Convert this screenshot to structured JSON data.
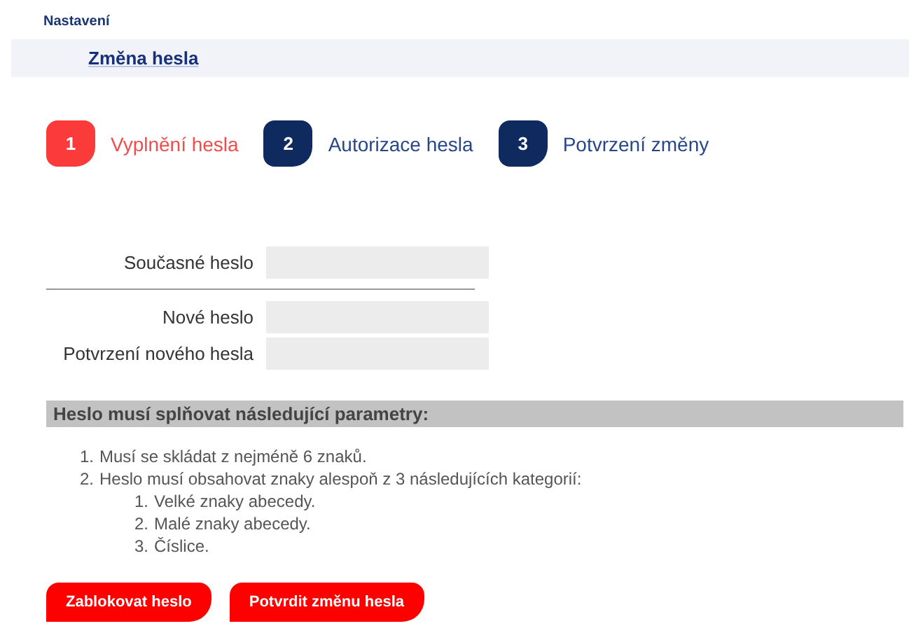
{
  "breadcrumb": "Nastavení",
  "page_title": "Změna hesla",
  "steps": [
    {
      "number": "1",
      "label": "Vyplnění hesla",
      "selected": true
    },
    {
      "number": "2",
      "label": "Autorizace hesla",
      "selected": false
    },
    {
      "number": "3",
      "label": "Potvrzení změny",
      "selected": false
    }
  ],
  "form": {
    "current": [
      {
        "label": "Současné heslo"
      }
    ],
    "new": [
      {
        "label": "Nové heslo"
      },
      {
        "label": "Potvrzení nového hesla"
      }
    ]
  },
  "rules": {
    "heading": "Heslo musí splňovat následující parametry:",
    "items": [
      {
        "number": "1.",
        "text": "Musí se skládat z nejméně 6 znaků."
      },
      {
        "number": "2.",
        "text": "Heslo musí obsahovat znaky alespoň z 3 následujících kategorií:",
        "children": [
          {
            "number": "1.",
            "text": "Velké znaky abecedy."
          },
          {
            "number": "2.",
            "text": "Malé znaky abecedy."
          },
          {
            "number": "3.",
            "text": "Číslice."
          }
        ]
      }
    ]
  },
  "buttons": [
    "Zablokovat heslo",
    "Potvrdit změnu hesla"
  ]
}
